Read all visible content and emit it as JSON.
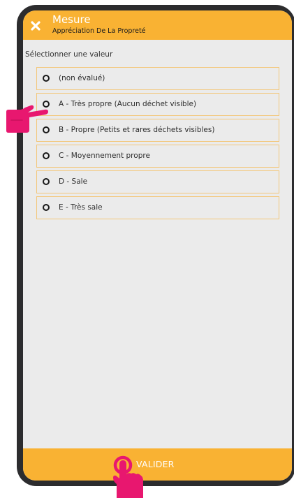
{
  "header": {
    "title": "Mesure",
    "subtitle": "Appréciation De La Propreté",
    "close_icon": "close-icon"
  },
  "prompt": "Sélectionner une valeur",
  "options": [
    {
      "label": "(non évalué)"
    },
    {
      "label": "A - Très propre (Aucun déchet visible)"
    },
    {
      "label": "B - Propre (Petits et rares déchets visibles)"
    },
    {
      "label": "C - Moyennement propre"
    },
    {
      "label": "D - Sale"
    },
    {
      "label": "E - Très sale"
    }
  ],
  "footer": {
    "validate_label": "VALIDER"
  },
  "colors": {
    "accent": "#f9b233",
    "pointer": "#e8176f",
    "device_frame": "#2c2c2e",
    "screen_background": "#ebebeb"
  },
  "annotations": {
    "left_pointer_icon": "pointing-hand-icon",
    "bottom_pointer_icon": "tap-hand-icon"
  }
}
